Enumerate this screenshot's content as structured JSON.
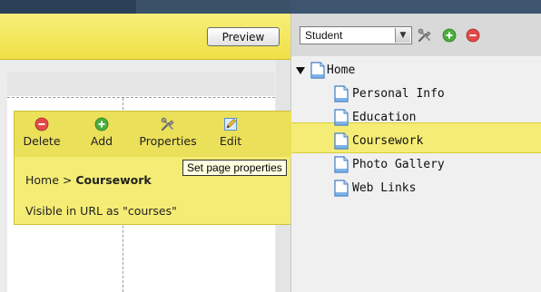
{
  "toolbar": {
    "preview_label": "Preview"
  },
  "sidebar": {
    "role_select": {
      "value": "Student"
    },
    "icons": [
      "tools-icon",
      "add-icon",
      "remove-icon"
    ],
    "tree": [
      {
        "label": "Home",
        "level": 0,
        "expanded": true
      },
      {
        "label": "Personal Info",
        "level": 1
      },
      {
        "label": "Education",
        "level": 1
      },
      {
        "label": "Coursework",
        "level": 1,
        "selected": true
      },
      {
        "label": "Photo Gallery",
        "level": 1
      },
      {
        "label": "Web Links",
        "level": 1
      }
    ]
  },
  "context_panel": {
    "buttons": [
      {
        "label": "Delete",
        "icon": "delete-icon"
      },
      {
        "label": "Add",
        "icon": "add-icon"
      },
      {
        "label": "Properties",
        "icon": "tools-icon"
      },
      {
        "label": "Edit",
        "icon": "pencil-icon"
      }
    ],
    "breadcrumb": {
      "root": "Home",
      "separator": ">",
      "current": "Coursework"
    },
    "url_note": "Visible in URL as \"courses\""
  },
  "tooltip": {
    "text": "Set page properties"
  },
  "colors": {
    "highlight_yellow": "#f4ec74",
    "toolbar_yellow": "#efe045",
    "top_strip": "#3d556e",
    "delete_red": "#e24a4a",
    "add_green": "#4cae3c"
  }
}
